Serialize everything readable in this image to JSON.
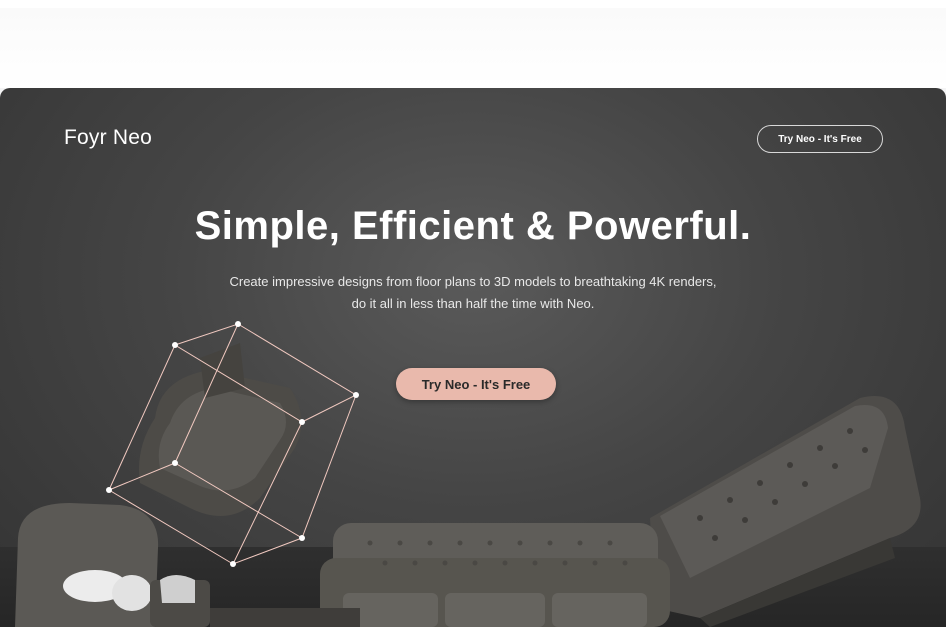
{
  "header": {
    "logo_text": "Foyr Neo",
    "nav_cta_label": "Try Neo - It's Free"
  },
  "hero": {
    "headline": "Simple, Efficient & Powerful.",
    "subtext": "Create impressive designs from floor plans to 3D models to breathtaking 4K renders, do it all in less than half the time with Neo.",
    "cta_label": "Try Neo - It's Free"
  },
  "colors": {
    "hero_bg": "#454545",
    "cta_bg": "#e9b9ac",
    "text": "#ffffff"
  }
}
